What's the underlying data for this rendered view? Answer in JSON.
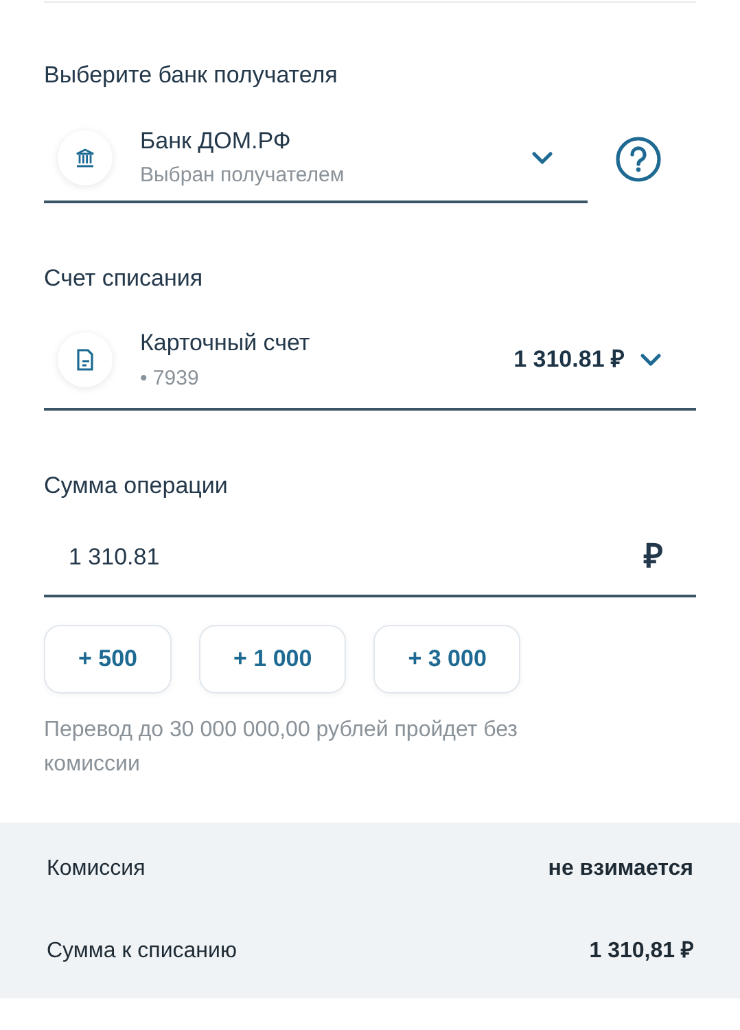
{
  "recipient_bank": {
    "label": "Выберите банк получателя",
    "name": "Банк ДОМ.РФ",
    "note": "Выбран получателем"
  },
  "account": {
    "label": "Счет списания",
    "name": "Карточный счет",
    "number": "• 7939",
    "balance": "1 310.81 ₽"
  },
  "amount": {
    "label": "Сумма операции",
    "value": "1 310.81",
    "currency": "₽"
  },
  "quick_amounts": [
    "+ 500",
    "+ 1 000",
    "+ 3 000"
  ],
  "hint": "Перевод до 30 000 000,00 рублей пройдет без комиссии",
  "summary": [
    {
      "label": "Комиссия",
      "value": "не взимается"
    },
    {
      "label": "Сумма к списанию",
      "value": "1 310,81 ₽"
    }
  ]
}
